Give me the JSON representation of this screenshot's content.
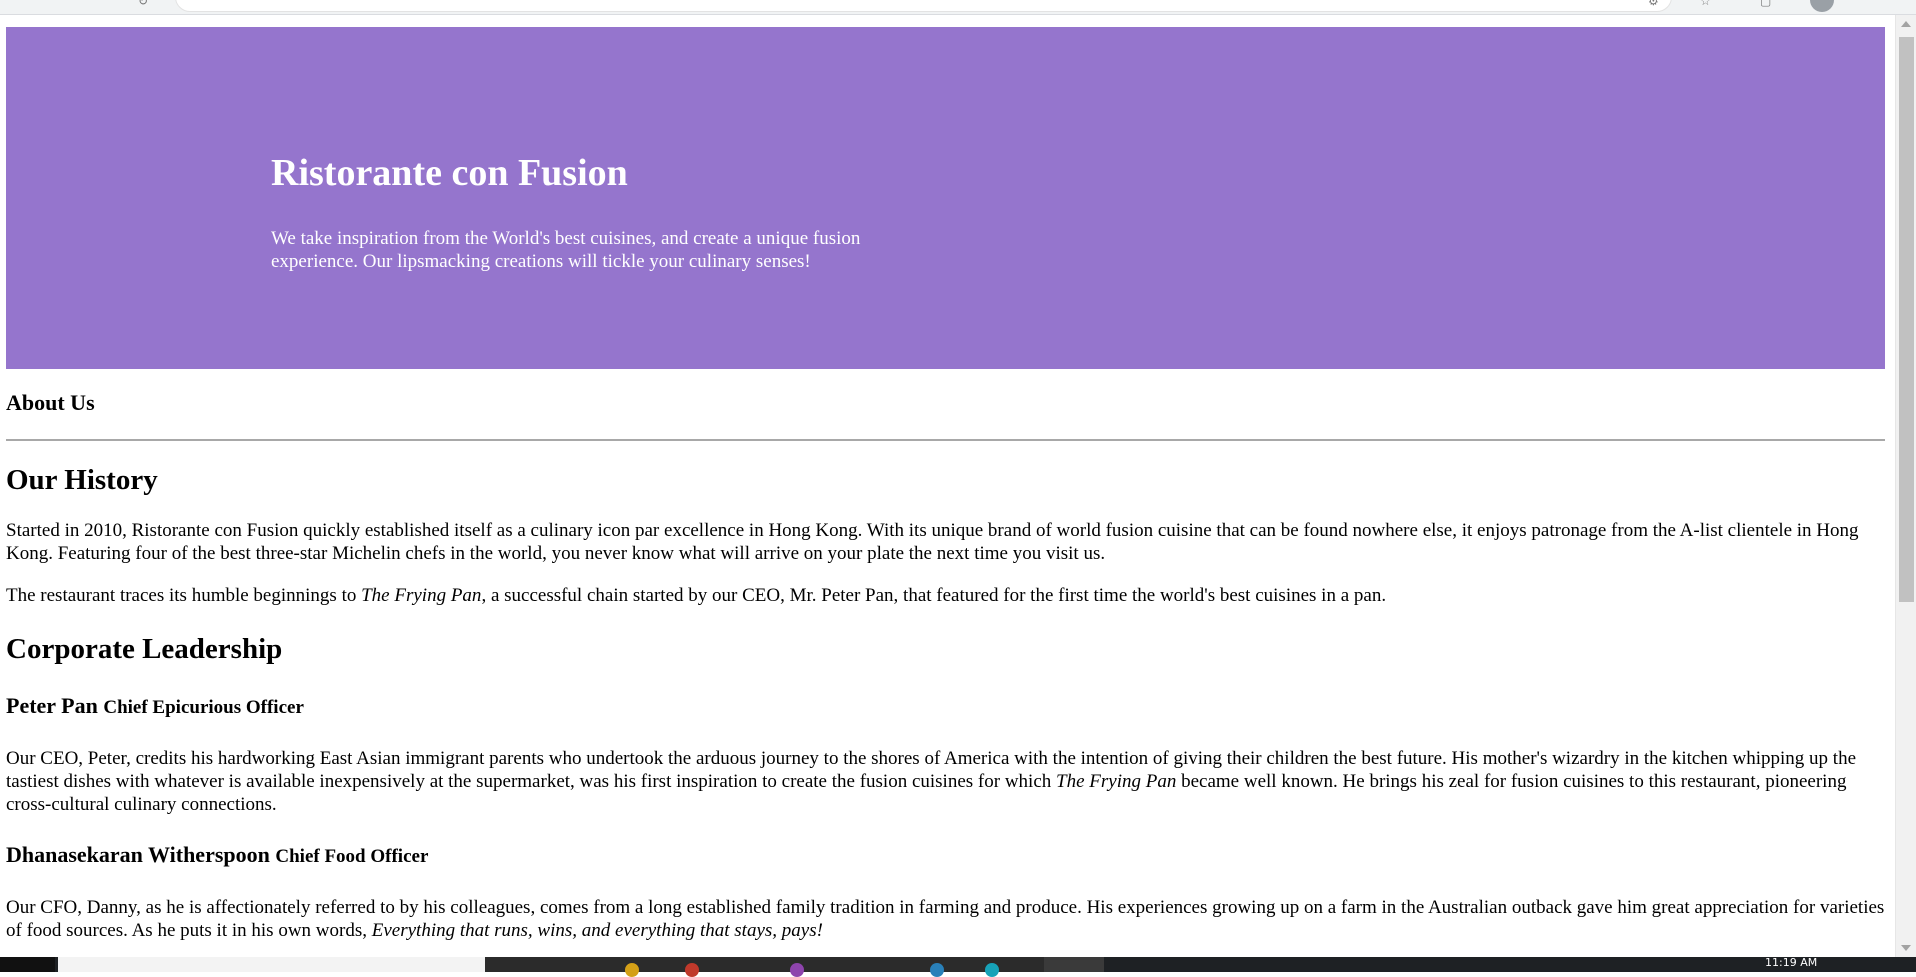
{
  "jumbotron": {
    "title": "Ristorante con Fusion",
    "tagline": "We take inspiration from the World's best cuisines, and create a unique fusion experience. Our lipsmacking creations will tickle your culinary senses!"
  },
  "about": {
    "heading": "About Us",
    "history_heading": "Our History",
    "history_p1": "Started in 2010, Ristorante con Fusion quickly established itself as a culinary icon par excellence in Hong Kong. With its unique brand of world fusion cuisine that can be found nowhere else, it enjoys patronage from the A-list clientele in Hong Kong. Featuring four of the best three-star Michelin chefs in the world, you never know what will arrive on your plate the next time you visit us.",
    "history_p2_before": "The restaurant traces its humble beginnings to ",
    "history_p2_em": "The Frying Pan",
    "history_p2_after": ", a successful chain started by our CEO, Mr. Peter Pan, that featured for the first time the world's best cuisines in a pan.",
    "leadership_heading": "Corporate Leadership"
  },
  "leaders": [
    {
      "name": "Peter Pan",
      "role": "Chief Epicurious Officer",
      "bio_before": "Our CEO, Peter, credits his hardworking East Asian immigrant parents who undertook the arduous journey to the shores of America with the intention of giving their children the best future. His mother's wizardry in the kitchen whipping up the tastiest dishes with whatever is available inexpensively at the supermarket, was his first inspiration to create the fusion cuisines for which ",
      "bio_em": "The Frying Pan",
      "bio_after": " became well known. He brings his zeal for fusion cuisines to this restaurant, pioneering cross-cultural culinary connections."
    },
    {
      "name": "Dhanasekaran Witherspoon",
      "role": "Chief Food Officer",
      "bio_before": "Our CFO, Danny, as he is affectionately referred to by his colleagues, comes from a long established family tradition in farming and produce. His experiences growing up on a farm in the Australian outback gave him great appreciation for varieties of food sources. As he puts it in his own words, ",
      "bio_em": "Everything that runs, wins, and everything that stays, pays!",
      "bio_after": ""
    }
  ],
  "taskbar": {
    "clock": "11:19 AM"
  },
  "colors": {
    "jumbotron_bg": "#9575cd",
    "jumbotron_text": "#ffffff"
  }
}
